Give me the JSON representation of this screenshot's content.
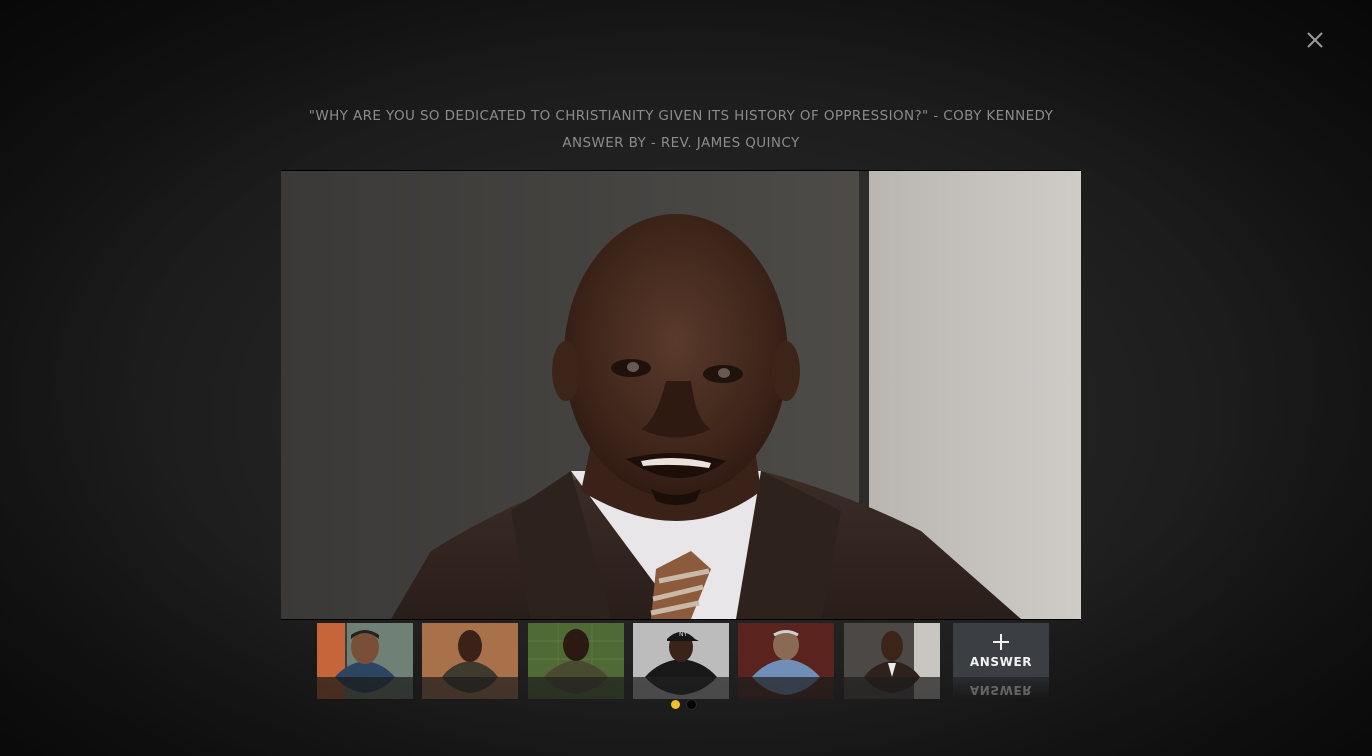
{
  "header": {
    "question": "\"WHY ARE YOU SO DEDICATED TO CHRISTIANITY GIVEN ITS HISTORY OF OPPRESSION?\" - COBY KENNEDY",
    "answer_by": "ANSWER BY - REV. JAMES QUINCY"
  },
  "close": {
    "icon": "close-icon"
  },
  "video": {
    "icon": "video-player"
  },
  "thumbnails": [
    {
      "icon": "answer-thumbnail-1"
    },
    {
      "icon": "answer-thumbnail-2"
    },
    {
      "icon": "answer-thumbnail-3"
    },
    {
      "icon": "answer-thumbnail-4"
    },
    {
      "icon": "answer-thumbnail-5"
    },
    {
      "icon": "answer-thumbnail-6"
    }
  ],
  "answer_button": {
    "icon": "plus-icon",
    "label": "ANSWER",
    "reflection": "ANSWER"
  },
  "pager": {
    "pages": 2,
    "active": 1
  },
  "colors": {
    "pager_active": "#f1c12a",
    "answer_button_bg": "#3b3e42",
    "text": "#8c8c8c"
  }
}
